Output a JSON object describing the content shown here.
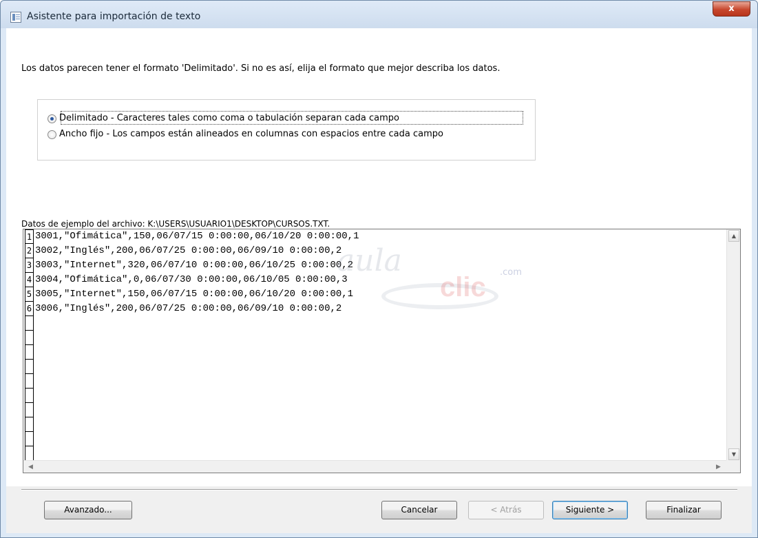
{
  "window": {
    "title": "Asistente para importación de texto",
    "close_label": "x"
  },
  "intro_text": "Los datos parecen tener el formato 'Delimitado'. Si no es así, elija el formato que mejor describa los datos.",
  "format_options": [
    {
      "label": "Delimitado - Caracteres tales como coma o tabulación separan cada campo",
      "selected": true
    },
    {
      "label": "Ancho fijo - Los campos están alineados en columnas con espacios entre cada campo",
      "selected": false
    }
  ],
  "sample": {
    "label": "Datos de ejemplo del archivo: K:\\USERS\\USUARIO1\\DESKTOP\\CURSOS.TXT.",
    "rows": [
      {
        "num": "1",
        "text": "3001,\"Ofimática\",150,06/07/15 0:00:00,06/10/20 0:00:00,1"
      },
      {
        "num": "2",
        "text": "3002,\"Inglés\",200,06/07/25 0:00:00,06/09/10 0:00:00,2"
      },
      {
        "num": "3",
        "text": "3003,\"Internet\",320,06/07/10 0:00:00,06/10/25 0:00:00,2"
      },
      {
        "num": "4",
        "text": "3004,\"Ofimática\",0,06/07/30 0:00:00,06/10/05 0:00:00,3"
      },
      {
        "num": "5",
        "text": "3005,\"Internet\",150,06/07/15 0:00:00,06/10/20 0:00:00,1"
      },
      {
        "num": "6",
        "text": "3006,\"Inglés\",200,06/07/25 0:00:00,06/09/10 0:00:00,2"
      },
      {
        "num": "",
        "text": ""
      },
      {
        "num": "",
        "text": ""
      },
      {
        "num": "",
        "text": ""
      },
      {
        "num": "",
        "text": ""
      },
      {
        "num": "",
        "text": ""
      },
      {
        "num": "",
        "text": ""
      },
      {
        "num": "",
        "text": ""
      },
      {
        "num": "",
        "text": ""
      },
      {
        "num": "",
        "text": ""
      },
      {
        "num": "",
        "text": ""
      }
    ]
  },
  "watermark": {
    "main": "aula",
    "com": ".com",
    "clic": "clic"
  },
  "buttons": {
    "advanced": "Avanzado...",
    "cancel": "Cancelar",
    "back": "< Atrás",
    "next": "Siguiente >",
    "finish": "Finalizar"
  },
  "icons": {
    "app": "table-import-icon",
    "close": "close-icon",
    "scroll_up": "arrow-up-icon",
    "scroll_down": "arrow-down-icon",
    "scroll_left": "arrow-left-icon",
    "scroll_right": "arrow-right-icon"
  }
}
